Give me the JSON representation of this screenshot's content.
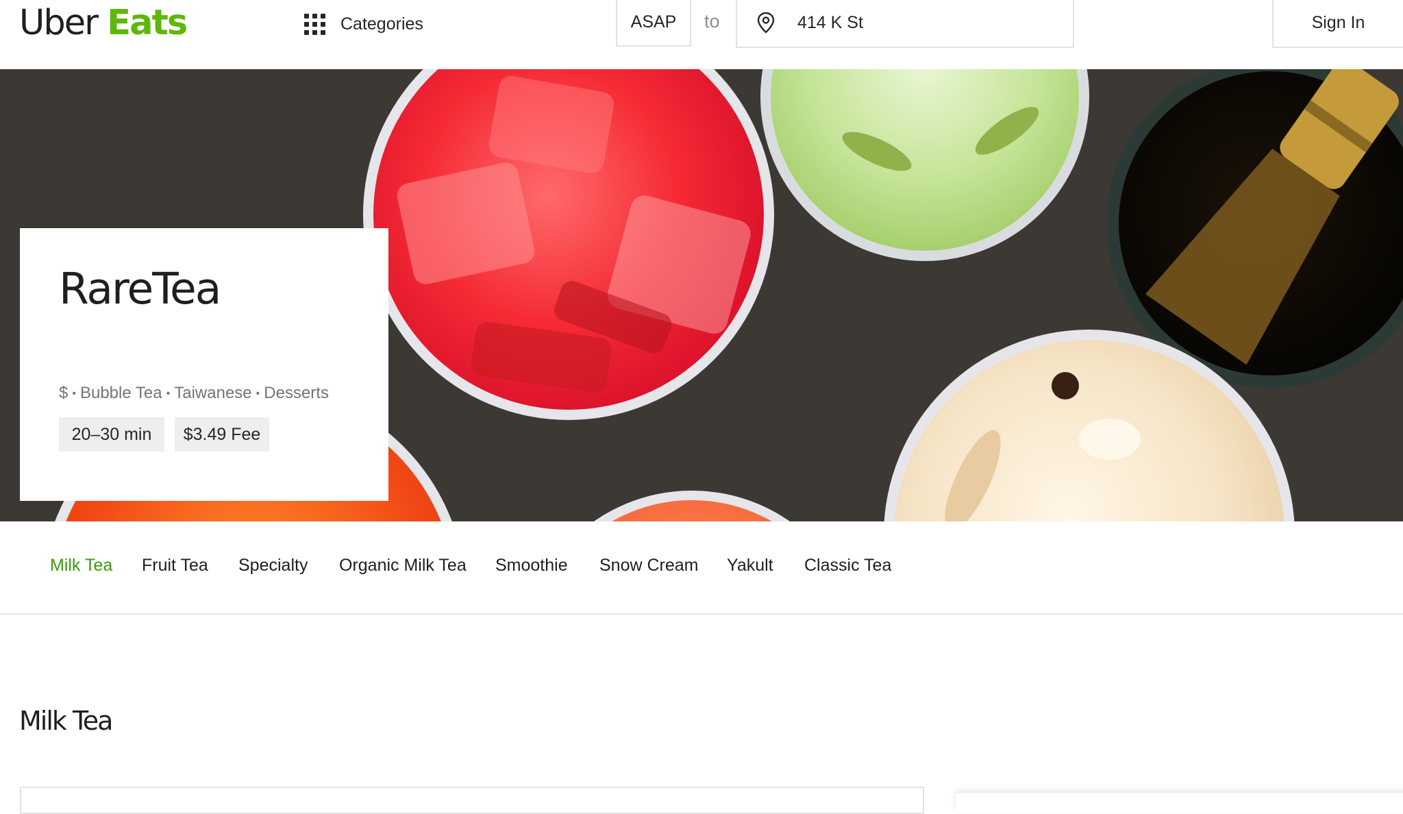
{
  "header": {
    "logo_primary": "Uber",
    "logo_secondary": "Eats",
    "categories_label": "Categories",
    "delivery_time": "ASAP",
    "to_label": "to",
    "address": "414 K St",
    "sign_in_label": "Sign In"
  },
  "store": {
    "name": "RareTea",
    "price_level": "$",
    "cuisines": [
      "Bubble Tea",
      "Taiwanese",
      "Desserts"
    ],
    "eta": "20–30 min",
    "fee": "$3.49 Fee"
  },
  "category_tabs": [
    {
      "label": "Milk Tea",
      "active": true
    },
    {
      "label": "Fruit Tea",
      "active": false
    },
    {
      "label": "Specialty",
      "active": false
    },
    {
      "label": "Organic Milk Tea",
      "active": false
    },
    {
      "label": "Smoothie",
      "active": false
    },
    {
      "label": "Snow Cream",
      "active": false
    },
    {
      "label": "Yakult",
      "active": false
    },
    {
      "label": "Classic Tea",
      "active": false
    }
  ],
  "section": {
    "title": "Milk Tea"
  },
  "icons": {
    "categories": "grid-icon",
    "address": "location-pin-icon"
  },
  "colors": {
    "brand_green": "#5fb709",
    "active_tab": "#3f9a0b"
  }
}
